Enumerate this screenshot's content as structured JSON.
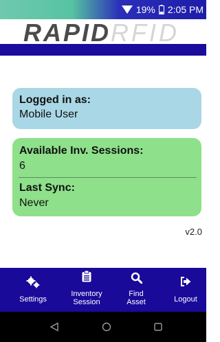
{
  "status_bar": {
    "battery": "19%",
    "time": "2:05 PM"
  },
  "brand": {
    "part1": "RAPID",
    "part2": "RFID"
  },
  "login_card": {
    "title": "Logged in as:",
    "user": "Mobile User"
  },
  "sessions_card": {
    "sessions_label": "Available Inv. Sessions:",
    "sessions_value": "6",
    "sync_label": "Last Sync:",
    "sync_value": "Never"
  },
  "version": "v2.0",
  "bottom_nav": {
    "items": [
      {
        "label": "Settings",
        "icon": "cogs-icon"
      },
      {
        "label": "Inventory Session",
        "line1": "Inventory",
        "line2": "Session",
        "icon": "clipboard-icon"
      },
      {
        "label": "Find Asset",
        "line1": "Find",
        "line2": "Asset",
        "icon": "search-icon"
      },
      {
        "label": "Logout",
        "icon": "logout-icon"
      }
    ]
  },
  "system_nav": [
    "back-icon",
    "home-icon",
    "recents-icon"
  ]
}
